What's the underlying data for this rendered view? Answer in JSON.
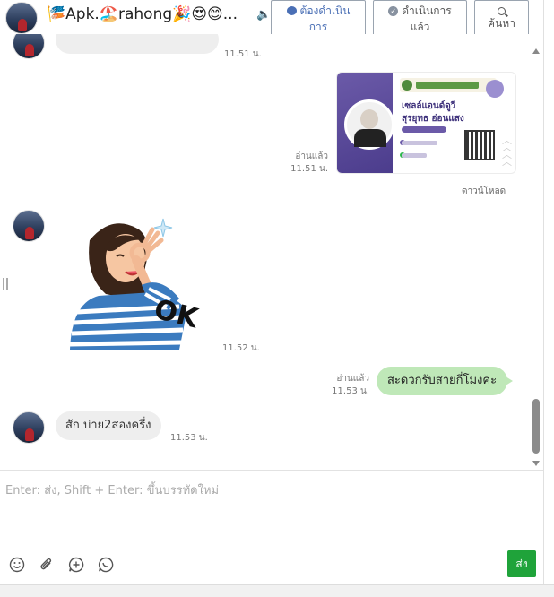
{
  "header": {
    "title": "🎏Apk.🏖️rahong🎉😍😊...",
    "speaker_icon": "speaker-icon",
    "btn_pending_line1": "ต้องดำเนิน",
    "btn_pending_line2": "การ",
    "btn_done_line1": "ดำเนินการ",
    "btn_done_line2": "แล้ว",
    "btn_search_label": "ค้นหา"
  },
  "messages": {
    "m0_time": "11.51 น.",
    "m1_read": "อ่านแล้ว",
    "m1_time": "11.51 น.",
    "m1_download": "ดาวน์โหลด",
    "card_name1": "เซลล์แอนด์ดูวี",
    "card_name2": "สุรยุทธ อ่อนแสง",
    "m2_time": "11.52 น.",
    "sticker_text": "OK",
    "m3_text": "สะดวกรับสายกี่โมงคะ",
    "m3_read": "อ่านแล้ว",
    "m3_time": "11.53 น.",
    "m4_text": "สัก บ่าย2สองครึ่ง",
    "m4_time": "11.53 น."
  },
  "composer": {
    "placeholder": "Enter: ส่ง, Shift + Enter: ขึ้นบรรทัดใหม่",
    "send_label": "ส่ง"
  },
  "colors": {
    "outgoing_bubble": "#bfe8b8",
    "incoming_bubble": "#eeeeee",
    "send_button": "#1fa33a",
    "link_blue": "#4a6fb5"
  }
}
